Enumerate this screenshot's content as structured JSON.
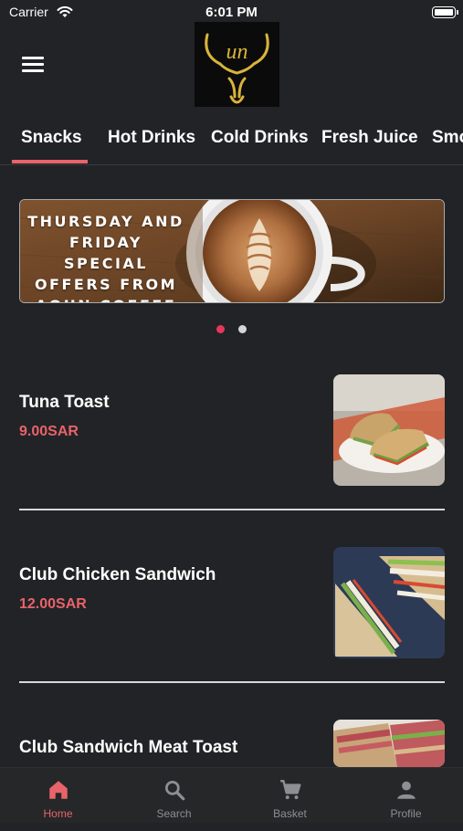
{
  "status_bar": {
    "carrier": "Carrier",
    "time": "6:01 PM"
  },
  "header": {
    "logo_text": "un"
  },
  "tabs": [
    {
      "label": "Snacks",
      "active": true
    },
    {
      "label": "Hot Drinks"
    },
    {
      "label": "Cold Drinks"
    },
    {
      "label": "Fresh Juice"
    },
    {
      "label": "Smo"
    }
  ],
  "banner": {
    "text": "THURSDAY AND FRIDAY SPECIAL OFFERS FROM AOUN COFFEE",
    "pages": 2,
    "current_page": 1
  },
  "items": [
    {
      "name": "Tuna Toast",
      "price": "9.00SAR"
    },
    {
      "name": "Club Chicken Sandwich",
      "price": "12.00SAR"
    },
    {
      "name": "Club Sandwich Meat Toast",
      "price": ""
    }
  ],
  "bottom_nav": [
    {
      "label": "Home",
      "icon": "home-icon",
      "active": true
    },
    {
      "label": "Search",
      "icon": "search-icon"
    },
    {
      "label": "Basket",
      "icon": "cart-icon"
    },
    {
      "label": "Profile",
      "icon": "profile-icon"
    }
  ],
  "colors": {
    "accent": "#e8636a",
    "background": "#222326",
    "nav_inactive": "#8e8f93"
  }
}
